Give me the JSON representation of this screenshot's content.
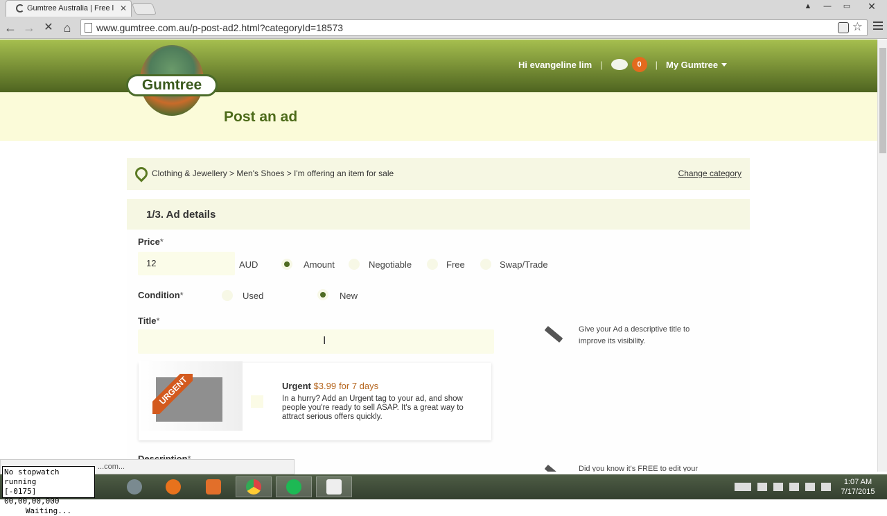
{
  "browser": {
    "tab_title": "Gumtree Australia | Free l",
    "tab_close": "✕",
    "url": "www.gumtree.com.au/p-post-ad2.html?categoryId=18573",
    "back": "←",
    "forward": "→",
    "stop": "✕",
    "home": "⌂",
    "star": "☆",
    "window_user": "▲",
    "window_min": "—",
    "window_max": "▭",
    "window_close": "✕"
  },
  "header": {
    "logo_text": "Gumtree",
    "greeting": "Hi  evangeline lim",
    "messages_count": "0",
    "my_gumtree": "My Gumtree",
    "sep": "|"
  },
  "page_title": "Post an ad",
  "breadcrumb": {
    "path": "Clothing & Jewellery > Men's Shoes > I'm offering an item for sale",
    "change_link": "Change category"
  },
  "section": {
    "title": "1/3. Ad details"
  },
  "form": {
    "price_label": "Price",
    "required_mark": "*",
    "price_value": "12",
    "currency": "AUD",
    "price_options": [
      "Amount",
      "Negotiable",
      "Free",
      "Swap/Trade"
    ],
    "price_selected": "Amount",
    "condition_label": "Condition",
    "condition_options": [
      "Used",
      "New"
    ],
    "condition_selected": "New",
    "title_label": "Title",
    "title_value": "",
    "title_tip": "Give your Ad a descriptive title to improve its visibility.",
    "description_label": "Description",
    "description_tip": "Did you know it's FREE to edit your"
  },
  "urgent": {
    "ribbon": "URGENT",
    "title": "Urgent",
    "price": "$3.99",
    "duration": "for 7 days",
    "description": "In a hurry? Add an Urgent tag to your ad, and show people you're ready to sell ASAP. It's a great way to attract serious offers quickly."
  },
  "status_bubble": "...com...",
  "stopwatch": {
    "line1": "No stopwatch running",
    "line2": "[-0175]  00,00,00,000",
    "line3": "Waiting..."
  },
  "taskbar": {
    "time": "1:07 AM",
    "date": "7/17/2015"
  },
  "colors": {
    "header_green": "#7a9137",
    "title_green": "#4d6b1a",
    "cream": "#fbfbd9",
    "accent_orange": "#e36a1e"
  }
}
